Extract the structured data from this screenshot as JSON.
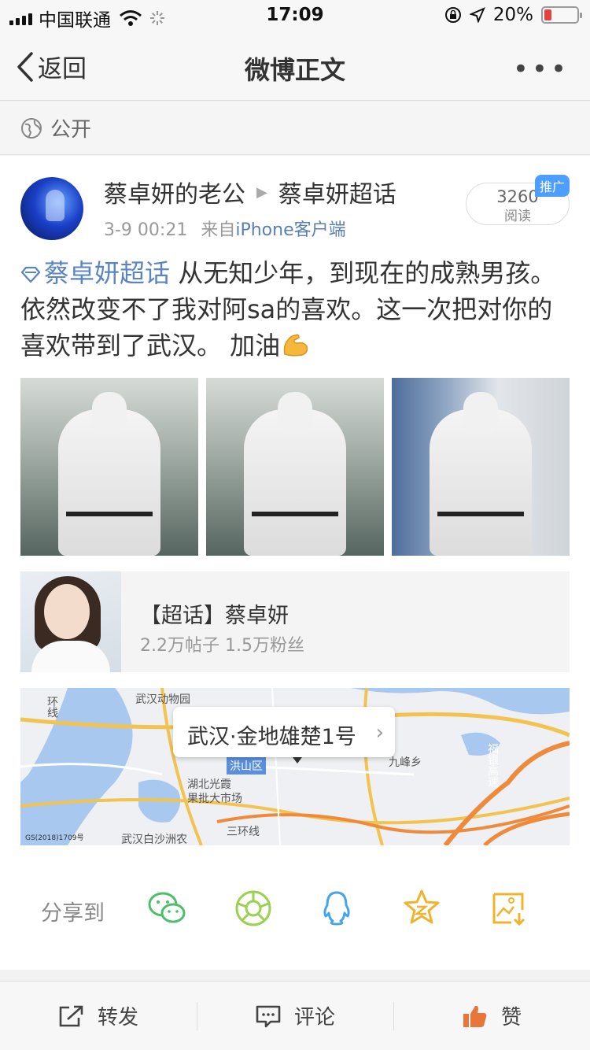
{
  "status_bar": {
    "carrier": "中国联通",
    "time": "17:09",
    "battery": "20%",
    "battery_level": 0.2,
    "battery_color": "#e64141"
  },
  "nav": {
    "back_label": "返回",
    "title": "微博正文",
    "more_label": "•••"
  },
  "visibility": {
    "icon": "globe-icon",
    "label": "公开"
  },
  "post": {
    "author": "蔡卓妍的老公",
    "topic_link": "蔡卓妍超话",
    "time": "3-9 00:21",
    "source_prefix": "来自",
    "source": "iPhone客户端",
    "read_count": "3260",
    "read_label": "阅读",
    "promo_badge": "推广",
    "topic_tag": "蔡卓妍超话",
    "text": " 从无知少年，到现在的成熟男孩。依然改变不了我对阿sa的喜欢。这一次把对你的喜欢带到了武汉。 加油",
    "topic_color": "#5b84c4"
  },
  "topic_card": {
    "title": "【超话】蔡卓妍",
    "stats": "2.2万帖子 1.5万粉丝"
  },
  "map": {
    "location": "武汉·金地雄楚1号",
    "labels": [
      "武汉动物园",
      "洪山区",
      "湖北光霞",
      "果批大市场",
      "九峰乡",
      "三环线",
      "武汉白沙洲农",
      "福银高速",
      "环线"
    ],
    "copyright": "GS(2018)1709号"
  },
  "share": {
    "label": "分享到",
    "targets": [
      "wechat-icon",
      "moments-icon",
      "qq-icon",
      "qzone-icon",
      "save-image-icon"
    ]
  },
  "bottom_bar": {
    "repost": "转发",
    "comment": "评论",
    "like": "赞",
    "like_color": "#e8763a"
  }
}
